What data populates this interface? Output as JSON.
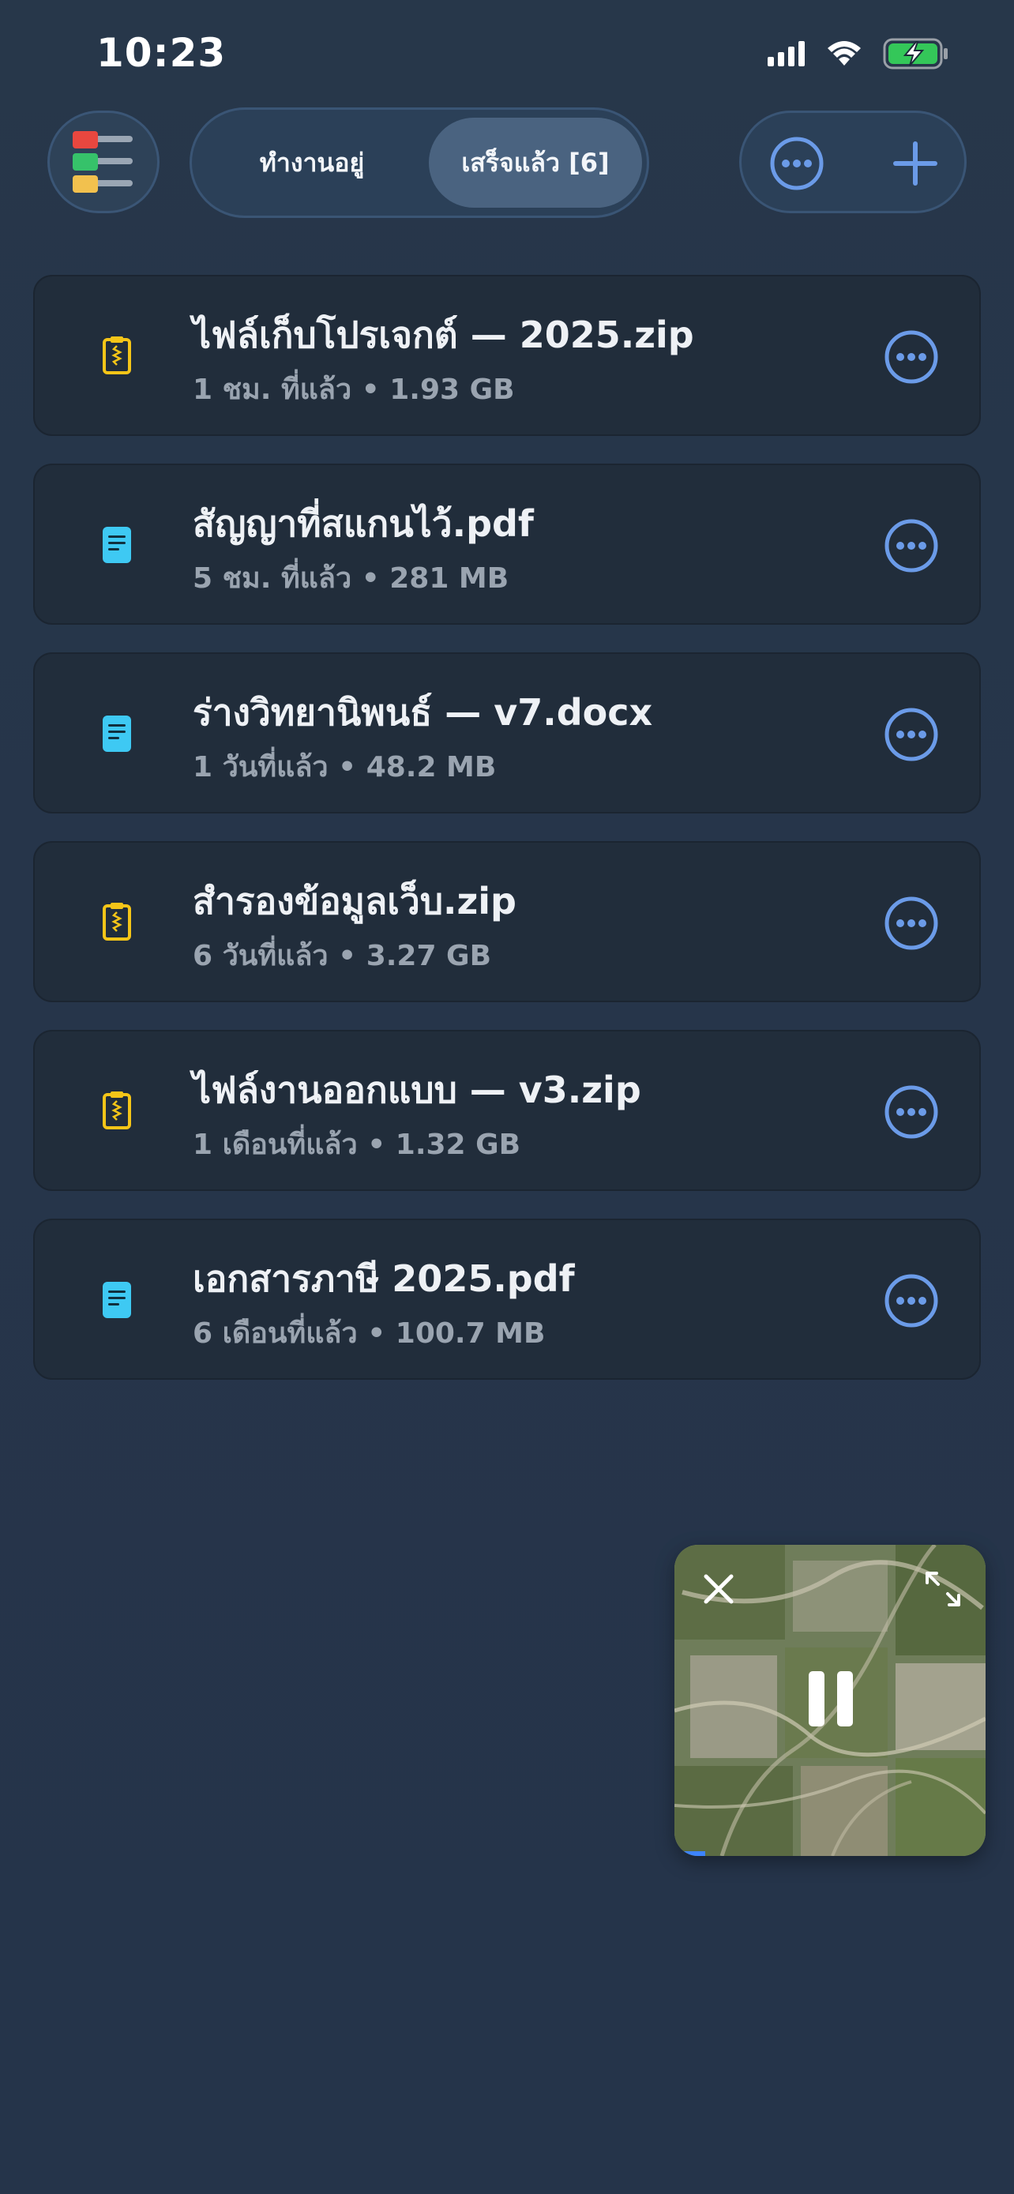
{
  "status_bar": {
    "time": "10:23"
  },
  "header": {
    "menu_icon": "color-lines-menu-icon",
    "tabs": [
      {
        "label": "ทำงานอยู่",
        "active": false
      },
      {
        "label": "เสร็จแล้ว [6]",
        "active": true
      }
    ],
    "more_icon": "ellipsis-circle-icon",
    "add_icon": "plus-icon"
  },
  "files": [
    {
      "name": "ไฟล์เก็บโปรเจกต์ — 2025.zip",
      "meta": "1 ชม. ที่แล้ว • 1.93 GB",
      "type": "zip"
    },
    {
      "name": "สัญญาที่สแกนไว้.pdf",
      "meta": "5 ชม. ที่แล้ว • 281 MB",
      "type": "doc"
    },
    {
      "name": "ร่างวิทยานิพนธ์ — v7.docx",
      "meta": "1 วันที่แล้ว • 48.2 MB",
      "type": "doc"
    },
    {
      "name": "สำรองข้อมูลเว็บ.zip",
      "meta": "6 วันที่แล้ว • 3.27 GB",
      "type": "zip"
    },
    {
      "name": "ไฟล์งานออกแบบ — v3.zip",
      "meta": "1 เดือนที่แล้ว • 1.32 GB",
      "type": "zip"
    },
    {
      "name": "เอกสารภาษี 2025.pdf",
      "meta": "6 เดือนที่แล้ว • 100.7 MB",
      "type": "doc"
    }
  ],
  "colors": {
    "accent": "#6b9be8",
    "zip_icon": "#f5c518",
    "doc_icon": "#3ec9f3",
    "progress": "#3d84ff"
  },
  "pip": {
    "close_icon": "close-icon",
    "expand_icon": "expand-icon",
    "pause_icon": "pause-icon",
    "progress": 0.1
  }
}
